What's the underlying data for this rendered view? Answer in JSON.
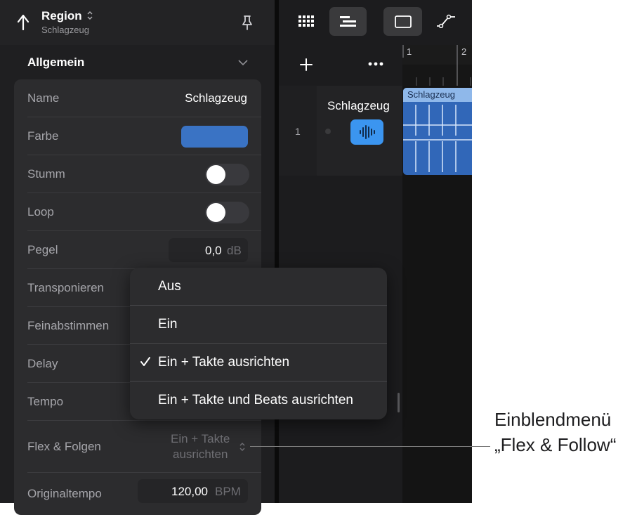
{
  "header": {
    "title": "Region",
    "subtitle": "Schlagzeug"
  },
  "section": {
    "title": "Allgemein"
  },
  "rows": {
    "name": {
      "label": "Name",
      "value": "Schlagzeug"
    },
    "color": {
      "label": "Farbe",
      "swatch": "#3a73c4"
    },
    "mute": {
      "label": "Stumm",
      "on": false
    },
    "loop": {
      "label": "Loop",
      "on": false
    },
    "gain": {
      "label": "Pegel",
      "value": "0,0",
      "unit": "dB"
    },
    "transpose": {
      "label": "Transponieren"
    },
    "finetune": {
      "label": "Feinabstimmen"
    },
    "delay": {
      "label": "Delay"
    },
    "tempo": {
      "label": "Tempo"
    },
    "flex": {
      "label": "Flex & Folgen",
      "value_line1": "Ein + Takte",
      "value_line2": "ausrichten"
    },
    "original_tempo": {
      "label": "Originaltempo",
      "value": "120,00",
      "unit": "BPM"
    }
  },
  "popup": {
    "items": [
      {
        "label": "Aus",
        "checked": false
      },
      {
        "label": "Ein",
        "checked": false
      },
      {
        "label": "Ein + Takte ausrichten",
        "checked": true
      },
      {
        "label": "Ein + Takte und Beats ausrichten",
        "checked": false
      }
    ]
  },
  "tracks": {
    "ruler": [
      "1",
      "2"
    ],
    "track": {
      "number": "1",
      "name": "Schlagzeug"
    },
    "region": {
      "name": "Schlagzeug"
    }
  },
  "callout": {
    "line1": "Einblendmenü",
    "line2": "„Flex & Follow“"
  }
}
